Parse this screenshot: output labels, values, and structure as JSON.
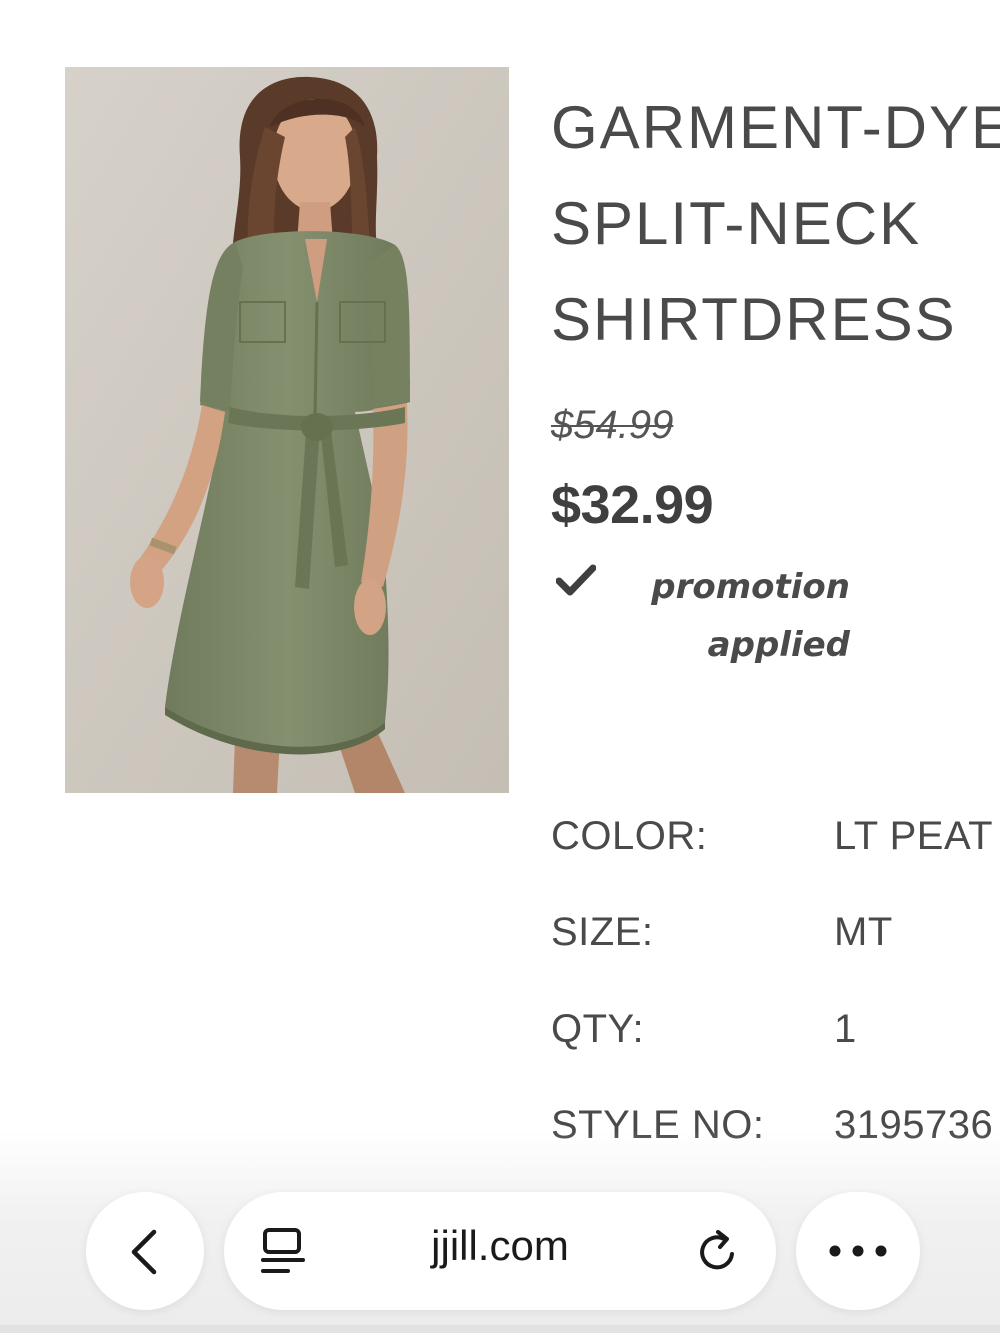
{
  "product": {
    "image_alt": "Model wearing green split-neck shirtdress",
    "title_lines": [
      "GARMENT-DYED",
      "SPLIT-NECK",
      "SHIRTDRESS"
    ],
    "original_price": "$54.99",
    "sale_price": "$32.99",
    "promotion_lines": [
      "promotion",
      "applied"
    ]
  },
  "attributes": [
    {
      "label": "COLOR:",
      "value": "LT PEAT"
    },
    {
      "label": "SIZE:",
      "value": "MT"
    },
    {
      "label": "QTY:",
      "value": "1"
    },
    {
      "label": "STYLE NO:",
      "value": "3195736"
    }
  ],
  "browser": {
    "url": "jjill.com",
    "icons": {
      "back": "chevron-left-icon",
      "tabs": "reader-icon",
      "reload": "reload-icon",
      "more": "more-dots-icon"
    }
  },
  "colors": {
    "dress": "#7d8a6a",
    "background_photo": "#cbc6bd",
    "text": "#4a4a4a"
  }
}
